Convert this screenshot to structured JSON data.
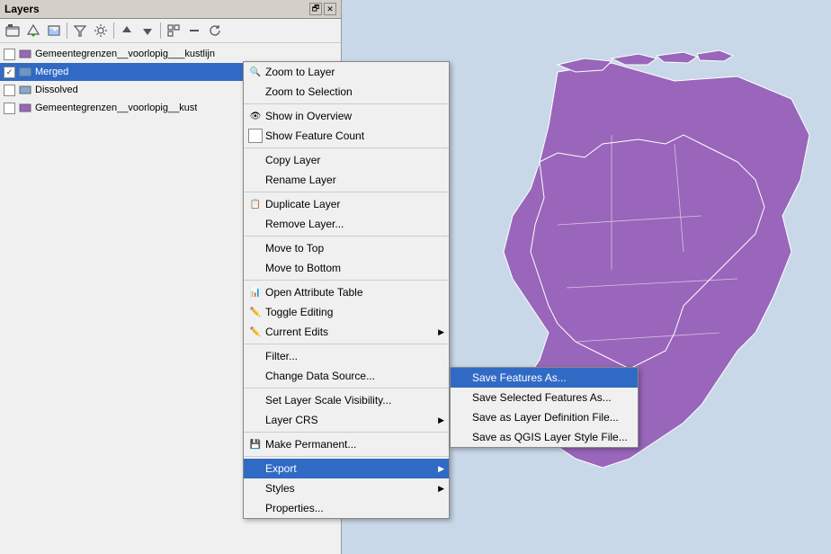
{
  "window": {
    "title": "Layers"
  },
  "toolbar": {
    "buttons": [
      "open-layer",
      "add-vector",
      "add-raster",
      "filter",
      "settings",
      "move-up",
      "move-down",
      "add-group",
      "expand",
      "collapse",
      "refresh"
    ]
  },
  "layers": [
    {
      "name": "Gemeentegrenzen__voorlopig___kustlijn",
      "checked": false,
      "type": "polygon",
      "color": "#8844aa",
      "selected": false
    },
    {
      "name": "Merged",
      "checked": true,
      "type": "polygon",
      "color": "#6699cc",
      "selected": true
    },
    {
      "name": "Dissolved",
      "checked": false,
      "type": "polygon",
      "color": "#88aacc",
      "selected": false
    },
    {
      "name": "Gemeentegrenzen__voorlopig__kust",
      "checked": false,
      "type": "polygon",
      "color": "#8844aa",
      "selected": false
    }
  ],
  "context_menu": {
    "items": [
      {
        "id": "zoom-to-layer",
        "label": "Zoom to Layer",
        "icon": "🔍",
        "type": "item"
      },
      {
        "id": "zoom-to-selection",
        "label": "Zoom to Selection",
        "icon": "",
        "type": "item"
      },
      {
        "id": "separator1",
        "type": "separator"
      },
      {
        "id": "show-in-overview",
        "label": "Show in Overview",
        "icon": "👁",
        "type": "item"
      },
      {
        "id": "show-feature-count",
        "label": "Show Feature Count",
        "icon": "",
        "type": "checkbox"
      },
      {
        "id": "separator2",
        "type": "separator"
      },
      {
        "id": "copy-layer",
        "label": "Copy Layer",
        "icon": "",
        "type": "item"
      },
      {
        "id": "rename-layer",
        "label": "Rename Layer",
        "icon": "",
        "type": "item"
      },
      {
        "id": "separator3",
        "type": "separator"
      },
      {
        "id": "duplicate-layer",
        "label": "Duplicate Layer",
        "icon": "📋",
        "type": "item"
      },
      {
        "id": "remove-layer",
        "label": "Remove Layer...",
        "icon": "",
        "type": "item"
      },
      {
        "id": "separator4",
        "type": "separator"
      },
      {
        "id": "move-to-top",
        "label": "Move to Top",
        "icon": "",
        "type": "item"
      },
      {
        "id": "move-to-bottom",
        "label": "Move to Bottom",
        "icon": "",
        "type": "item"
      },
      {
        "id": "separator5",
        "type": "separator"
      },
      {
        "id": "open-attribute-table",
        "label": "Open Attribute Table",
        "icon": "📊",
        "type": "item"
      },
      {
        "id": "toggle-editing",
        "label": "Toggle Editing",
        "icon": "✏️",
        "type": "item"
      },
      {
        "id": "current-edits",
        "label": "Current Edits",
        "icon": "✏️",
        "type": "submenu"
      },
      {
        "id": "separator6",
        "type": "separator"
      },
      {
        "id": "filter",
        "label": "Filter...",
        "icon": "",
        "type": "item"
      },
      {
        "id": "change-data-source",
        "label": "Change Data Source...",
        "icon": "",
        "type": "item"
      },
      {
        "id": "separator7",
        "type": "separator"
      },
      {
        "id": "set-layer-scale-visibility",
        "label": "Set Layer Scale Visibility...",
        "icon": "",
        "type": "item"
      },
      {
        "id": "layer-crs",
        "label": "Layer CRS",
        "icon": "",
        "type": "submenu"
      },
      {
        "id": "separator8",
        "type": "separator"
      },
      {
        "id": "make-permanent",
        "label": "Make Permanent...",
        "icon": "💾",
        "type": "item"
      },
      {
        "id": "separator9",
        "type": "separator"
      },
      {
        "id": "export",
        "label": "Export",
        "icon": "",
        "type": "submenu",
        "highlighted": true
      },
      {
        "id": "styles",
        "label": "Styles",
        "icon": "",
        "type": "submenu"
      },
      {
        "id": "properties",
        "label": "Properties...",
        "icon": "",
        "type": "item"
      }
    ]
  },
  "submenu": {
    "items": [
      {
        "id": "save-features-as",
        "label": "Save Features As...",
        "active": true
      },
      {
        "id": "save-selected-features-as",
        "label": "Save Selected Features As..."
      },
      {
        "id": "save-as-layer-definition",
        "label": "Save as Layer Definition File..."
      },
      {
        "id": "save-as-qgis-style",
        "label": "Save as QGIS Layer Style File..."
      }
    ]
  },
  "map": {
    "bg_color": "#c8d8e8",
    "netherlands_color": "#9966bb",
    "netherlands_border": "#ffffff"
  }
}
